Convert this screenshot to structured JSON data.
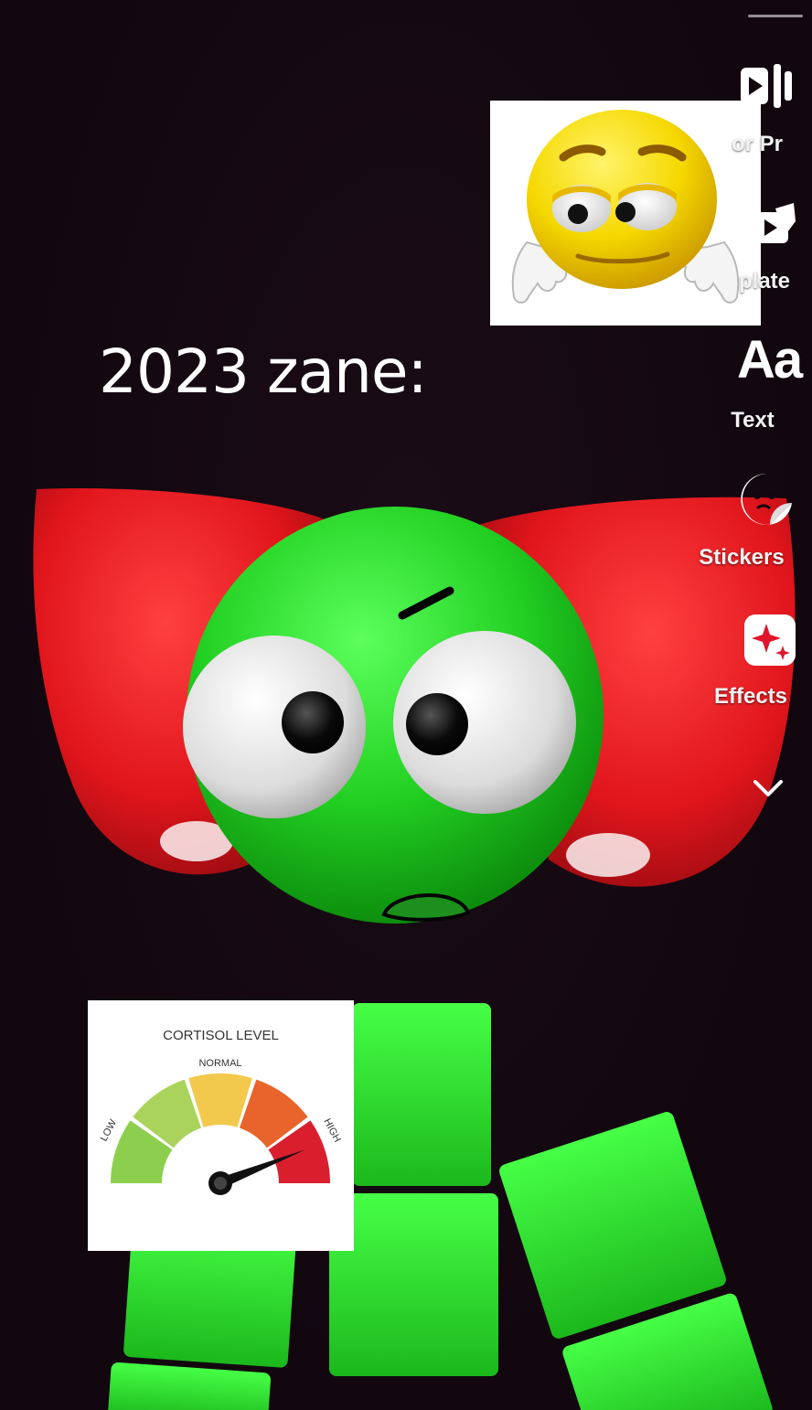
{
  "caption": "2023 zane:",
  "gauge": {
    "title": "CORTISOL LEVEL",
    "labels": {
      "low": "LOW",
      "normal": "NORMAL",
      "high": "HIGH"
    },
    "level": 0.88,
    "colors": {
      "low": "#8ccf4e",
      "low_mid": "#a9d35a",
      "normal": "#f2c94c",
      "high_mid": "#e8642c",
      "high": "#d91f2e"
    }
  },
  "side_menu": {
    "items": [
      {
        "label": "or Pr",
        "icon": "teleprompter-icon"
      },
      {
        "label": "plate",
        "icon": "template-icon"
      },
      {
        "label": "Text",
        "icon": "text-aa-icon",
        "glyph": "Aa"
      },
      {
        "label": "Stickers",
        "icon": "sticker-icon"
      },
      {
        "label": "Effects",
        "icon": "effects-sparkle-icon"
      }
    ],
    "expand_icon": "chevron-down-icon"
  },
  "colors": {
    "background": "#12070f",
    "character_green": "#22d022",
    "wing_red": "#e0151c",
    "emoji_yellow": "#f5d800"
  }
}
